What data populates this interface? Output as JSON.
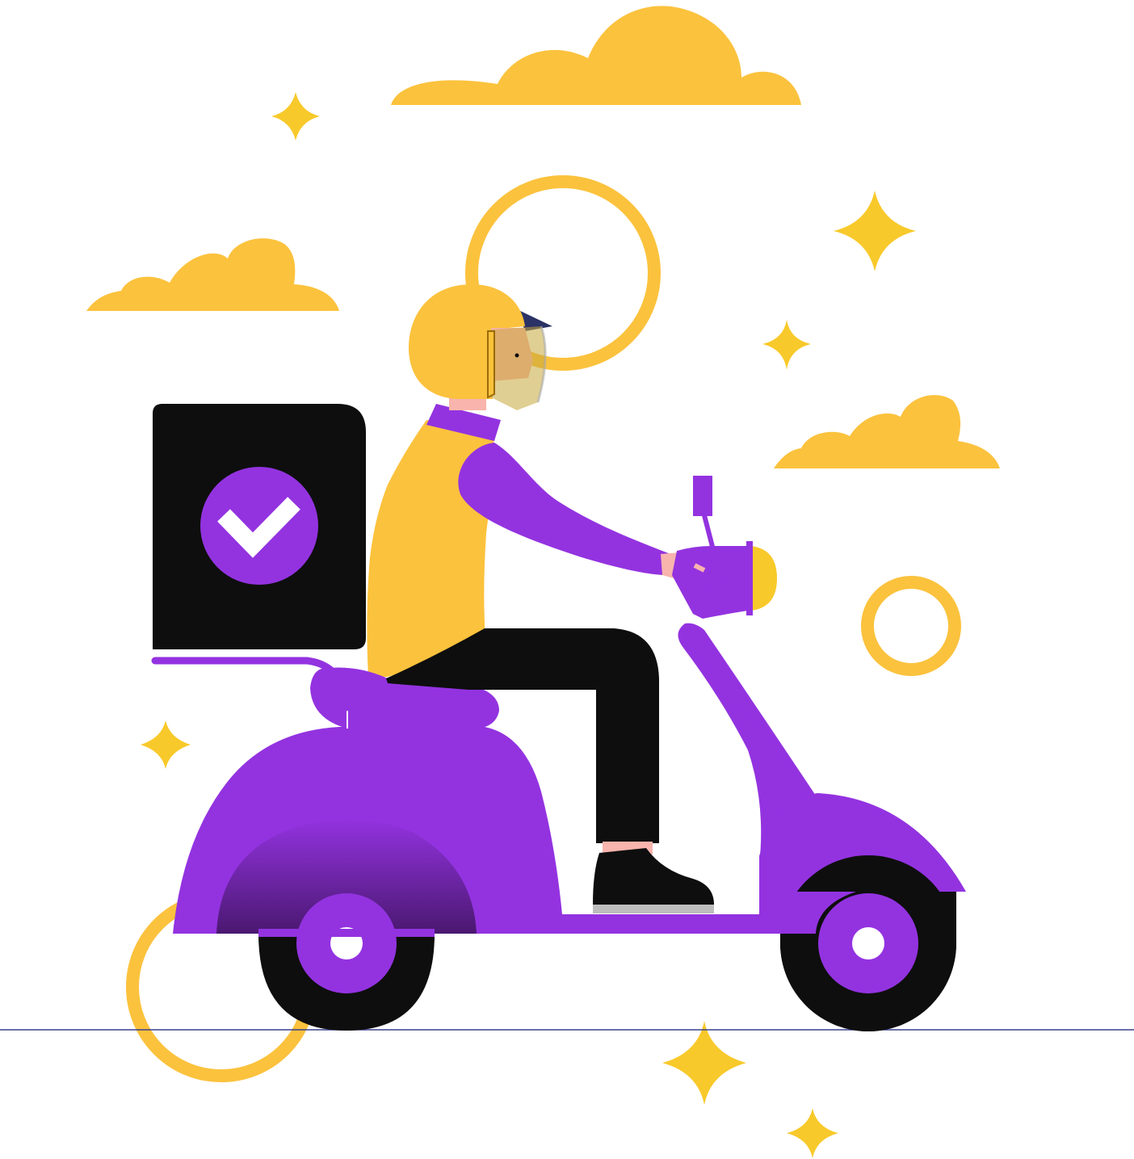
{
  "illustration": {
    "subject": "delivery-rider-on-scooter",
    "colors": {
      "background": "#ffffff",
      "yellow": "#fbc23d",
      "star_yellow": "#f8c92a",
      "purple": "#9333e0",
      "purple_dark": "#4a1870",
      "black": "#0e0e0e",
      "skin": "#f8b4ad",
      "ground_line": "#3b3f8f",
      "sole_gray": "#bdbdbd",
      "visor_navy": "#2b3266"
    },
    "icons": {
      "box_badge": "check-icon",
      "decorations": [
        "cloud-icon",
        "sparkle-icon",
        "ring-icon"
      ]
    }
  }
}
